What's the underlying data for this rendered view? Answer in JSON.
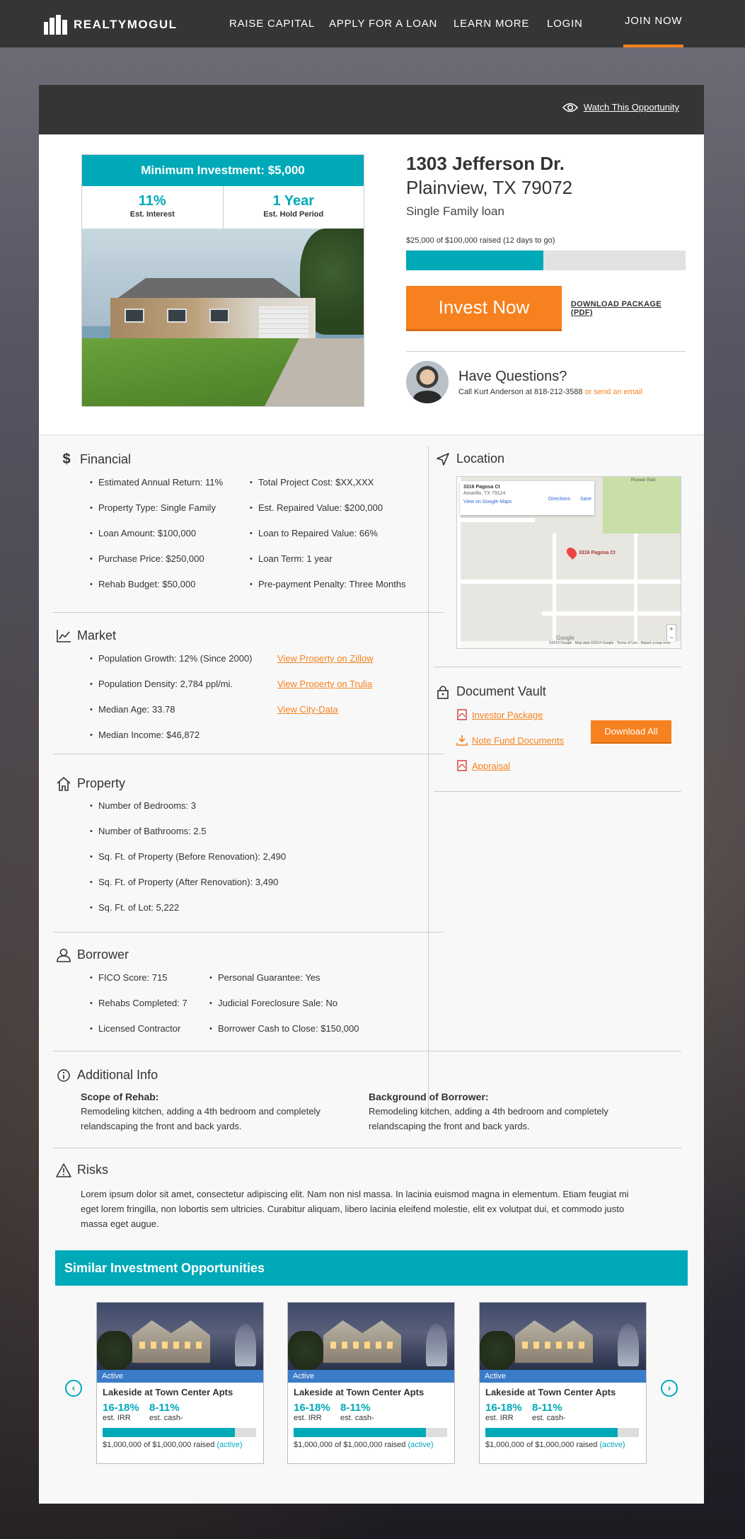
{
  "brand": {
    "name": "REALTYMOGUL",
    "accent": "#f7811e",
    "teal": "#00a9b8"
  },
  "nav": {
    "items": [
      "RAISE CAPITAL",
      "APPLY FOR A LOAN",
      "LEARN MORE",
      "LOGIN"
    ],
    "join": "JOIN NOW"
  },
  "watch": "Watch This Opportunity",
  "investment": {
    "minimum": "Minimum Investment: $5,000",
    "interest": "11%",
    "interest_label": "Est. Interest",
    "hold": "1 Year",
    "hold_label": "Est. Hold Period"
  },
  "property": {
    "address1": "1303 Jefferson Dr.",
    "address2": "Plainview, TX 79072",
    "type": "Single Family loan",
    "raised": "$25,000 of $100,000 raised (12 days to go)",
    "progress": 0.49
  },
  "actions": {
    "invest": "Invest Now",
    "download_pkg": "DOWNLOAD PACKAGE (PDF)"
  },
  "questions": {
    "title": "Have Questions?",
    "text": "Call Kurt Anderson at 818-212-3588",
    "link": "or send an email"
  },
  "financial": {
    "title": "Financial",
    "left": [
      "Estimated Annual Return: 11%",
      "Property Type: Single Family",
      "Loan Amount: $100,000",
      "Purchase Price: $250,000",
      "Rehab Budget: $50,000"
    ],
    "right": [
      "Total Project Cost: $XX,XXX",
      "Est. Repaired Value: $200,000",
      "Loan to Repaired Value: 66%",
      "Loan Term: 1 year",
      "Pre-payment Penalty: Three Months"
    ]
  },
  "market": {
    "title": "Market",
    "items": [
      "Population Growth: 12% (Since 2000)",
      "Population Density: 2,784 ppl/mi.",
      "Median Age: 33.78",
      "Median Income: $46,872"
    ],
    "links": [
      "View Property on Zillow",
      "View Property on Trulia",
      "View City-Data"
    ]
  },
  "propsec": {
    "title": "Property",
    "items": [
      "Number of Bedrooms: 3",
      "Number of Bathrooms: 2.5",
      "Sq. Ft. of Property (Before Renovation): 2,490",
      "Sq. Ft. of Property (After Renovation): 3,490",
      "Sq. Ft. of Lot: 5,222"
    ]
  },
  "borrower": {
    "title": "Borrower",
    "left": [
      "FICO Score: 715",
      "Rehabs Completed: 7",
      "Licensed Contractor"
    ],
    "right": [
      "Personal Guarantee: Yes",
      "Judicial Foreclosure Sale: No",
      "Borrower Cash to Close: $150,000"
    ]
  },
  "location": {
    "title": "Location",
    "map_place": "3316 Pagosa Ct",
    "map_sub": "Amarillo, TX 79124",
    "map_link": "View on Google Maps",
    "directions": "Directions",
    "save": "Save",
    "park": "Pioneer Park",
    "pin_label": "3316 Pagosa Ct",
    "google": "Google",
    "map_footer": "©2014 Google · Map data ©2014 Google · Terms of Use · Report a map error"
  },
  "vault": {
    "title": "Document Vault",
    "docs": [
      "Investor Package",
      "Note Fund Documents",
      "Appraisal"
    ],
    "download_all": "Download All"
  },
  "additional": {
    "title": "Additional Info",
    "scope_title": "Scope of Rehab:",
    "scope_text": "Remodeling kitchen, adding a 4th bedroom and completely relandscaping the front and back yards.",
    "bg_title": "Background of Borrower:",
    "bg_text": "Remodeling kitchen, adding a 4th bedroom and completely relandscaping the front and back yards."
  },
  "risks": {
    "title": "Risks",
    "text": "Lorem ipsum dolor sit amet, consectetur adipiscing elit. Nam non nisl massa. In lacinia euismod magna in elementum. Etiam feugiat mi eget lorem fringilla, non lobortis sem ultricies. Curabitur aliquam, libero lacinia eleifend molestie, elit ex volutpat dui, et commodo justo massa eget augue."
  },
  "similar": {
    "title": "Similar Investment Opportunities",
    "items": [
      {
        "status": "Active",
        "name": "Lakeside at Town Center Apts",
        "irr": "16-18%",
        "irr_label": "est. IRR",
        "cash": "8-11%",
        "cash_label": "est. cash-",
        "raised": "$1,000,000 of $1,000,000 raised",
        "raised_status": "(active)",
        "progress": 0.86
      },
      {
        "status": "Active",
        "name": "Lakeside at Town Center Apts",
        "irr": "16-18%",
        "irr_label": "est. IRR",
        "cash": "8-11%",
        "cash_label": "est. cash-",
        "raised": "$1,000,000 of $1,000,000 raised",
        "raised_status": "(active)",
        "progress": 0.86
      },
      {
        "status": "Active",
        "name": "Lakeside at Town Center Apts",
        "irr": "16-18%",
        "irr_label": "est. IRR",
        "cash": "8-11%",
        "cash_label": "est. cash-",
        "raised": "$1,000,000 of $1,000,000 raised",
        "raised_status": "(active)",
        "progress": 0.86
      }
    ]
  }
}
